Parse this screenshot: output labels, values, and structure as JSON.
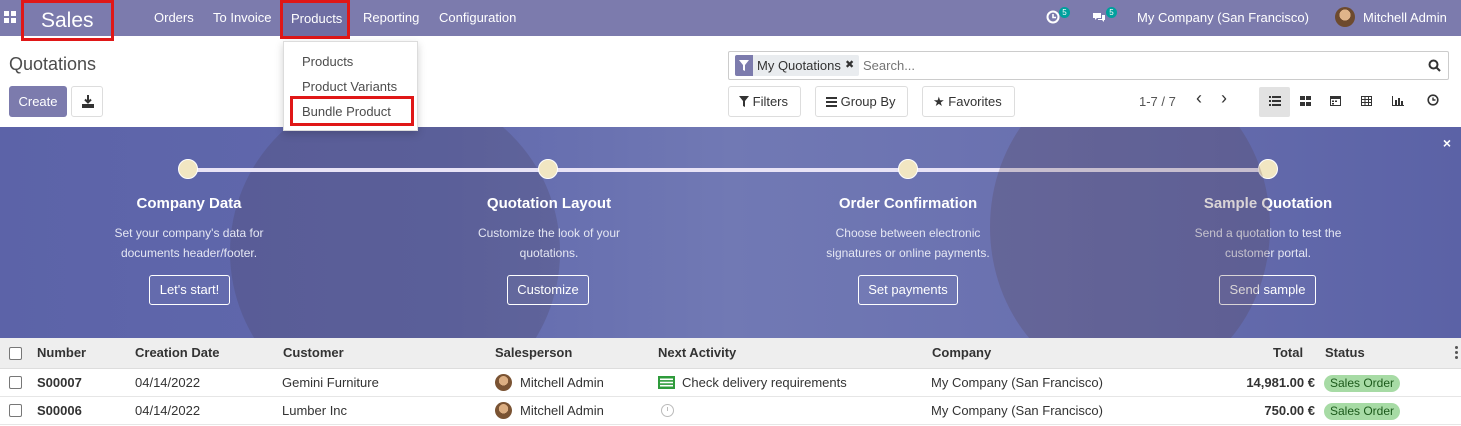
{
  "navbar": {
    "app_name": "Sales",
    "menu": [
      "Orders",
      "To Invoice",
      "Products",
      "Reporting",
      "Configuration"
    ],
    "activity_count": "5",
    "messages_count": "5",
    "company": "My Company (San Francisco)",
    "user": "Mitchell Admin"
  },
  "products_menu": {
    "items": [
      "Products",
      "Product Variants",
      "Bundle Product"
    ]
  },
  "control_panel": {
    "title": "Quotations",
    "create_label": "Create",
    "facet_label": "My Quotations",
    "facet_remove": "✖",
    "search_placeholder": "Search...",
    "filters_label": "Filters",
    "groupby_label": "Group By",
    "favorites_label": "Favorites",
    "pager": "1-7 / 7",
    "prev": "‹",
    "next": "›"
  },
  "onboarding": {
    "close": "×",
    "steps": [
      {
        "title": "Company Data",
        "desc1": "Set your company's data for",
        "desc2": "documents header/footer.",
        "button": "Let's start!"
      },
      {
        "title": "Quotation Layout",
        "desc1": "Customize the look of your",
        "desc2": "quotations.",
        "button": "Customize"
      },
      {
        "title": "Order Confirmation",
        "desc1": "Choose between electronic",
        "desc2": "signatures or online payments.",
        "button": "Set payments"
      },
      {
        "title": "Sample Quotation",
        "desc1": "Send a quotation to test the",
        "desc2": "customer portal.",
        "button": "Send sample"
      }
    ]
  },
  "table": {
    "columns": [
      "Number",
      "Creation Date",
      "Customer",
      "Salesperson",
      "Next Activity",
      "Company",
      "Total",
      "Status"
    ],
    "rows": [
      {
        "number": "S00007",
        "date": "04/14/2022",
        "customer": "Gemini Furniture",
        "salesperson": "Mitchell Admin",
        "activity": "Check delivery requirements",
        "company": "My Company (San Francisco)",
        "total": "14,981.00 €",
        "status": "Sales Order"
      },
      {
        "number": "S00006",
        "date": "04/14/2022",
        "customer": "Lumber Inc",
        "salesperson": "Mitchell Admin",
        "activity": "",
        "company": "My Company (San Francisco)",
        "total": "750.00 €",
        "status": "Sales Order"
      }
    ]
  },
  "colors": {
    "navbar": "#7c7bad",
    "highlight": "#e01717",
    "status_badge": "#a7dba5"
  }
}
